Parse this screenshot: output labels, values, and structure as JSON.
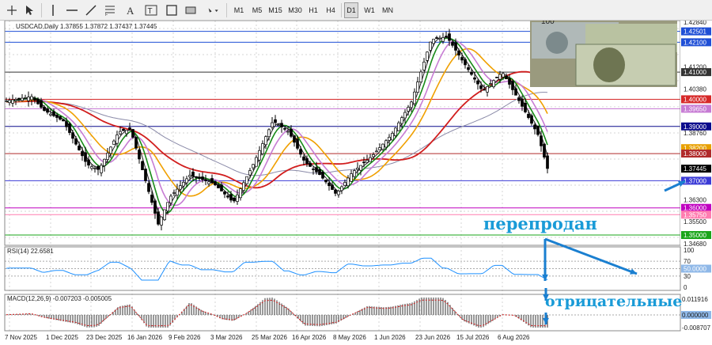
{
  "toolbar": {
    "timeframes": [
      "M1",
      "M5",
      "M15",
      "M30",
      "H1",
      "H4",
      "D1",
      "W1",
      "MN"
    ],
    "active_timeframe": "D1"
  },
  "main_chart": {
    "header": "USDCAD,Daily  1.37855 1.37872 1.37437 1.37445",
    "price_labels": [
      "1.42840",
      "1.42501",
      "1.42100",
      "1.41200",
      "1.41000",
      "1.40380",
      "1.40000",
      "1.39650",
      "1.39000",
      "1.38760",
      "1.38200",
      "1.38000",
      "1.37445",
      "1.37000",
      "1.36300",
      "1.36000",
      "1.35750",
      "1.35500",
      "1.35000",
      "1.34680"
    ],
    "badges": {
      "1.42501": "#1f4fd6",
      "1.42100": "#1f4fd6",
      "1.41000": "#333333",
      "1.40000": "#d62828",
      "1.39650": "#c77cd4",
      "1.39000": "#0a0a8c",
      "1.38200": "#e8a000",
      "1.38000": "#b02a2a",
      "1.37445": "#000000",
      "1.37000": "#3b3bd6",
      "1.36000": "#c000c0",
      "1.35750": "#ff7db0",
      "1.35000": "#1aa51a"
    }
  },
  "rsi": {
    "header": "RSI(14) 22.6581",
    "levels": [
      "100",
      "70",
      "50.0000",
      "30",
      "0"
    ]
  },
  "macd": {
    "header": "MACD(12,26,9) -0.007203 -0.005005",
    "levels": [
      "0.011916",
      "0.000000",
      "-0.008707"
    ]
  },
  "dates": [
    "7 Nov 2025",
    "1 Dec 2025",
    "23 Dec 2025",
    "16 Jan 2026",
    "9 Feb 2026",
    "3 Mar 2026",
    "25 Mar 2026",
    "16 Apr 2026",
    "8 May 2026",
    "1 Jun 2026",
    "23 Jun 2026",
    "15 Jul 2026",
    "6 Aug 2026"
  ],
  "annotations": {
    "oversold": "перепродан",
    "negative": "отрицательные"
  },
  "thumbnail": {
    "banknote_text": "100"
  }
}
